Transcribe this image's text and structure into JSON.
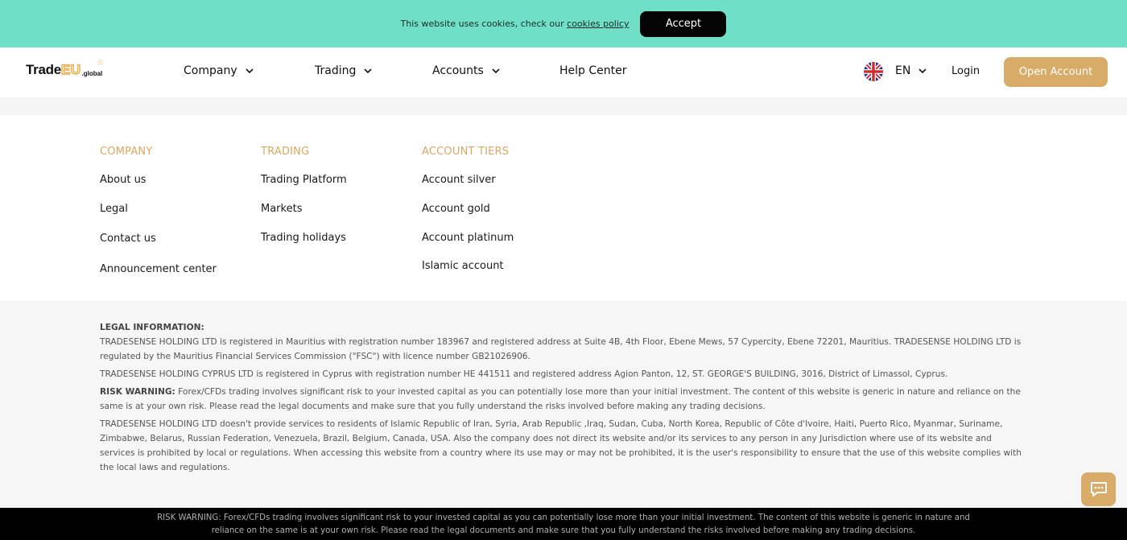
{
  "cookie": {
    "text": "This website uses cookies, check our",
    "link": "cookies policy",
    "accept": "Accept",
    "bg_color": "#6fe0c7"
  },
  "header": {
    "logo": {
      "part1": "Trade",
      "part2": "EU",
      "part3": ".global"
    },
    "nav": [
      {
        "label": "Company",
        "has_dropdown": true
      },
      {
        "label": "Trading",
        "has_dropdown": true
      },
      {
        "label": "Accounts",
        "has_dropdown": true
      },
      {
        "label": "Help Center",
        "has_dropdown": false
      }
    ],
    "language": "EN",
    "flag": "uk-flag-icon",
    "login": "Login",
    "open_account": "Open Account",
    "accent_color": "#d8ab68"
  },
  "footer_links": {
    "company": {
      "title": "COMPANY",
      "items": [
        "About us",
        "Legal",
        "Contact us",
        "Announcement center"
      ]
    },
    "trading": {
      "title": "TRADING",
      "items": [
        "Trading Platform",
        "Markets",
        "Trading holidays"
      ]
    },
    "accounts": {
      "title": "ACCOUNT TIERS",
      "items": [
        "Account silver",
        "Account gold",
        "Account platinum",
        "Islamic account"
      ]
    }
  },
  "legal": {
    "title": "LEGAL INFORMATION:",
    "p1": "TRADESENSE HOLDING LTD is registered in Mauritius with registration number 183967 and registered address at Suite 4B, 4th Floor, Ebene Mews, 57 Cypercity, Ebene 72201, Mauritius. TRADESENSE HOLDING LTD is regulated by the Mauritius Financial Services Commission (\"FSC\") with licence number GB21026906.",
    "p2": "TRADESENSE HOLDING CYPRUS LTD is registered in Cyprus with registration number HE 441511 and registered address Agion Panton, 12, ST. GEORGE'S BUILDING, 3016, District of Limassol, Cyprus.",
    "risk_label": "RISK WARNING:",
    "p3": " Forex/CFDs trading involves significant risk to your invested capital as you can potentially lose more than your initial investment. The content of this website is generic in nature and reliance on the same is at your own risk. Please read the legal documents and make sure that you fully understand the risks involved before making any trading decisions.",
    "p4": "TRADESENSE HOLDING LTD  doesn't provide services to residents of Islamic Republic of Iran, Syria, Arab Republic ,Iraq, Sudan, Cuba, North Korea, Republic of Côte d'Ivoire, Haiti, Puerto Rico, Myanmar, Suriname, Zimbabwe, Belarus, Russian Federation, Venezuela, Brazil, Belgium, Canada, USA. Also the company does not direct its website and/or its services to any person in any Jurisdiction where use of its website and services is prohibited by local or regulations. When accessing this website from a country where its use may or may not be prohibited, it is the user's responsibility to ensure that the use of this website complies with the local laws and regulations."
  },
  "bottom_bar": {
    "line1": "RISK WARNING: Forex/CFDs trading involves significant risk to your invested capital as you can potentially lose more than your initial investment. The content of this website is generic in nature and",
    "line2": "reliance on the same is at your own risk. Please read the legal documents and make sure that you fully understand the risks involved before making any trading decisions."
  },
  "chat": {
    "icon": "chat-icon"
  }
}
